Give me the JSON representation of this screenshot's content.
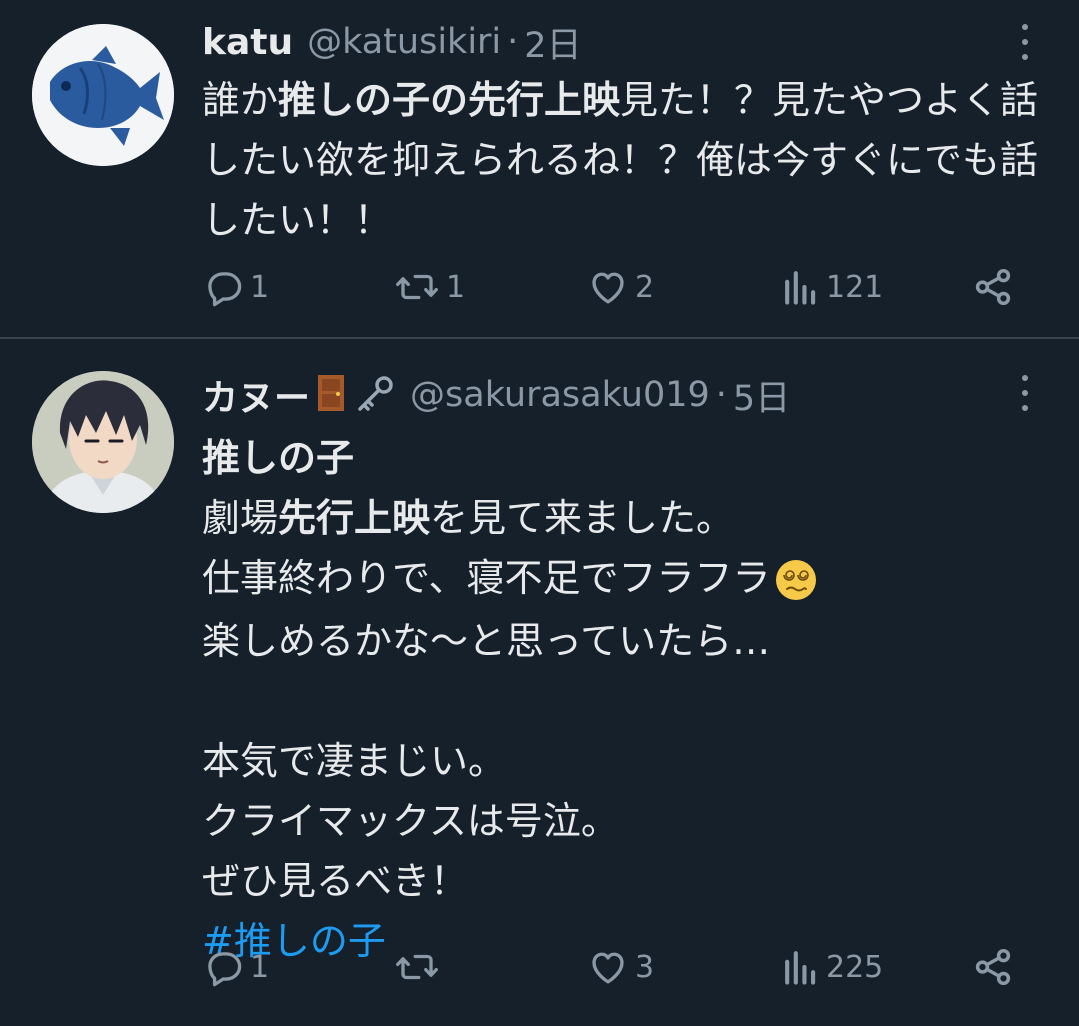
{
  "tweets": [
    {
      "author_name": "katu",
      "handle": "@katusikiri",
      "separator": "·",
      "time": "2日",
      "body_segments": [
        {
          "text": "誰か",
          "bold": false
        },
        {
          "text": "推しの子の先行上映",
          "bold": true
        },
        {
          "text": "見た！？見たやつよく話したい欲を抑えられるね！？俺は今すぐにでも話したい！！",
          "bold": false
        }
      ],
      "actions": {
        "reply": "1",
        "retweet": "1",
        "like": "2",
        "views": "121"
      }
    },
    {
      "author_name": "カヌー",
      "name_emojis": [
        "door-emoji",
        "key-emoji"
      ],
      "handle": "@sakurasaku019",
      "separator": "·",
      "time": "5日",
      "lines": {
        "l1": "推しの子",
        "l2a": "劇場",
        "l2b": "先行上映",
        "l2c": "を見て来ました。",
        "l3": "仕事終わりで、寝不足でフラフラ",
        "l4": "楽しめるかな〜と思っていたら…",
        "l5": "本気で凄まじい。",
        "l6": "クライマックスは号泣。",
        "l7": "ぜひ見るべき！",
        "hashtag": "#推しの子"
      },
      "actions": {
        "reply": "1",
        "retweet": "",
        "like": "3",
        "views": "225"
      }
    }
  ],
  "colors": {
    "background": "#15202b",
    "text": "#e7e9ea",
    "secondary": "#8b98a5",
    "link": "#1d9bf0",
    "divider": "#38444d"
  }
}
